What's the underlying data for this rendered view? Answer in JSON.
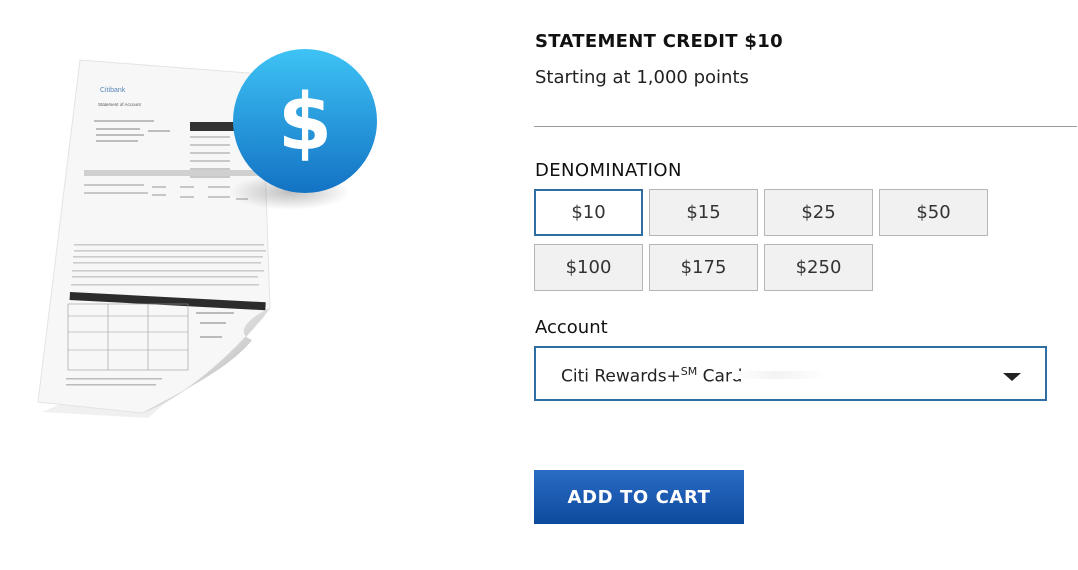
{
  "product": {
    "title": "STATEMENT CREDIT $10",
    "subtitle": "Starting at 1,000 points"
  },
  "illustration": {
    "icon": "dollar-coin-icon",
    "coin_symbol": "$",
    "doc_brand": "Citibank",
    "doc_title": "Statement of Account",
    "coin_color": "#1a8fd8"
  },
  "denomination": {
    "label": "DENOMINATION",
    "options": [
      "$10",
      "$15",
      "$25",
      "$50",
      "$100",
      "$175",
      "$250"
    ],
    "selected": "$10"
  },
  "account": {
    "label": "Account",
    "selected_name": "Citi Rewards+",
    "selected_mark": "SM",
    "selected_suffix": " Card",
    "dropdown_icon": "caret-down-icon"
  },
  "cart": {
    "button_label": "ADD TO CART",
    "button_color": "#1559b3"
  },
  "colors": {
    "selected_border": "#2f6ea3",
    "option_bg": "#f1f1f1"
  }
}
